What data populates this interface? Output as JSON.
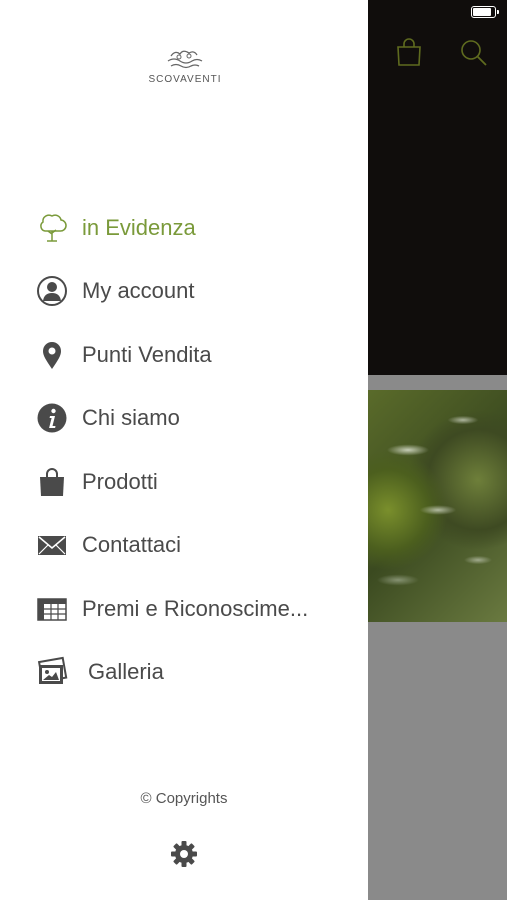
{
  "status_bar": {
    "battery_level": 1.0
  },
  "background_app": {
    "top_icons": [
      "shopping-bag-icon",
      "search-icon"
    ],
    "accent_color": "#5f6b1f"
  },
  "drawer": {
    "logo_text": "SCOVAVENTI",
    "menu": [
      {
        "label": "in Evidenza",
        "icon": "tree-icon",
        "active": true
      },
      {
        "label": "My account",
        "icon": "user-icon",
        "active": false
      },
      {
        "label": "Punti Vendita",
        "icon": "location-pin-icon",
        "active": false
      },
      {
        "label": "Chi siamo",
        "icon": "info-icon",
        "active": false
      },
      {
        "label": "Prodotti",
        "icon": "shopping-bag-icon",
        "active": false
      },
      {
        "label": "Contattaci",
        "icon": "envelope-icon",
        "active": false
      },
      {
        "label": "Premi e Riconoscime...",
        "icon": "table-icon",
        "active": false
      },
      {
        "label": "Galleria",
        "icon": "gallery-icon",
        "active": false
      }
    ],
    "copyright": "© Copyrights",
    "settings_icon": "gear-icon"
  },
  "colors": {
    "active": "#7a9a3a",
    "text": "#4a4a4a",
    "icon": "#4a4a4a",
    "backdrop_dark": "#100d0c",
    "backdrop_gray": "#8a8a8a"
  }
}
